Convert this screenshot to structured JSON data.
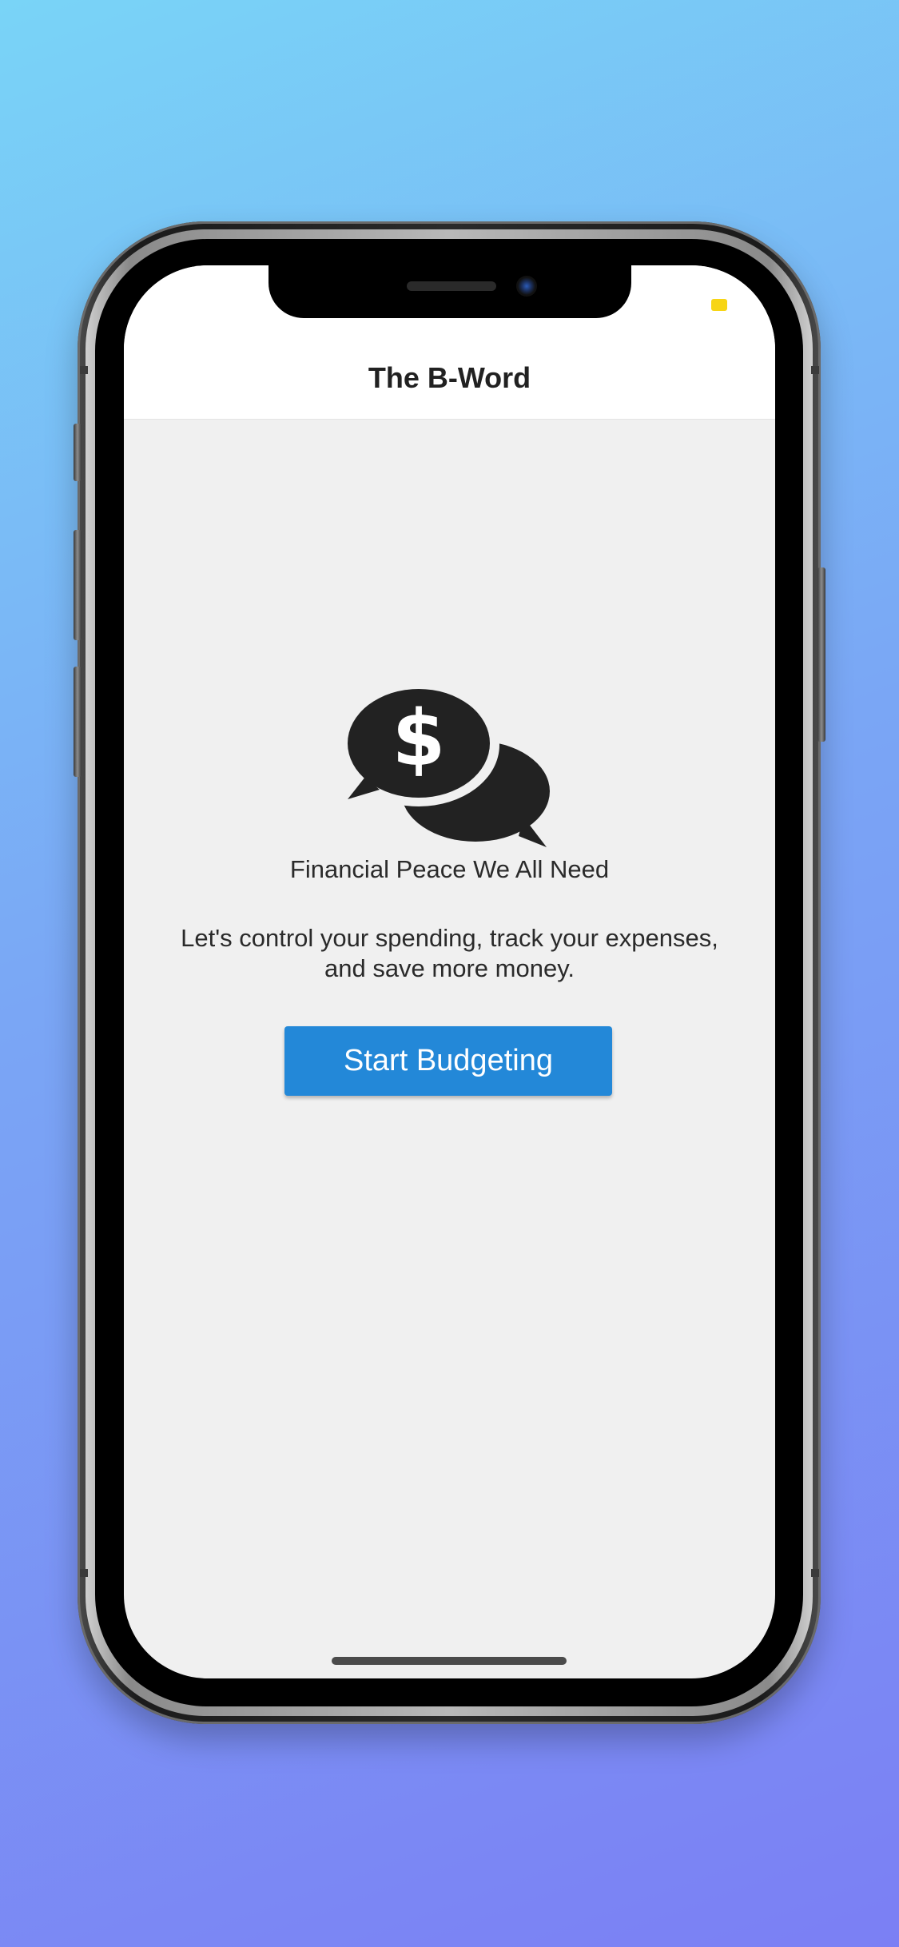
{
  "app": {
    "title": "The B-Word"
  },
  "main": {
    "logo_icon": "chat-bubbles-dollar-icon",
    "dollar_glyph": "$",
    "tagline": "Financial Peace We All Need",
    "description_line1": "Let's control your spending, track your expenses,",
    "description_line2": "and save more money.",
    "cta_label": "Start Budgeting"
  },
  "colors": {
    "background_top": "#79d4f7",
    "background_bottom": "#7b7ff4",
    "primary_button": "#2388d8",
    "screen_background": "#f0f0f0",
    "header_background": "#ffffff",
    "icon": "#222222",
    "status_indicator": "#f7d515"
  }
}
